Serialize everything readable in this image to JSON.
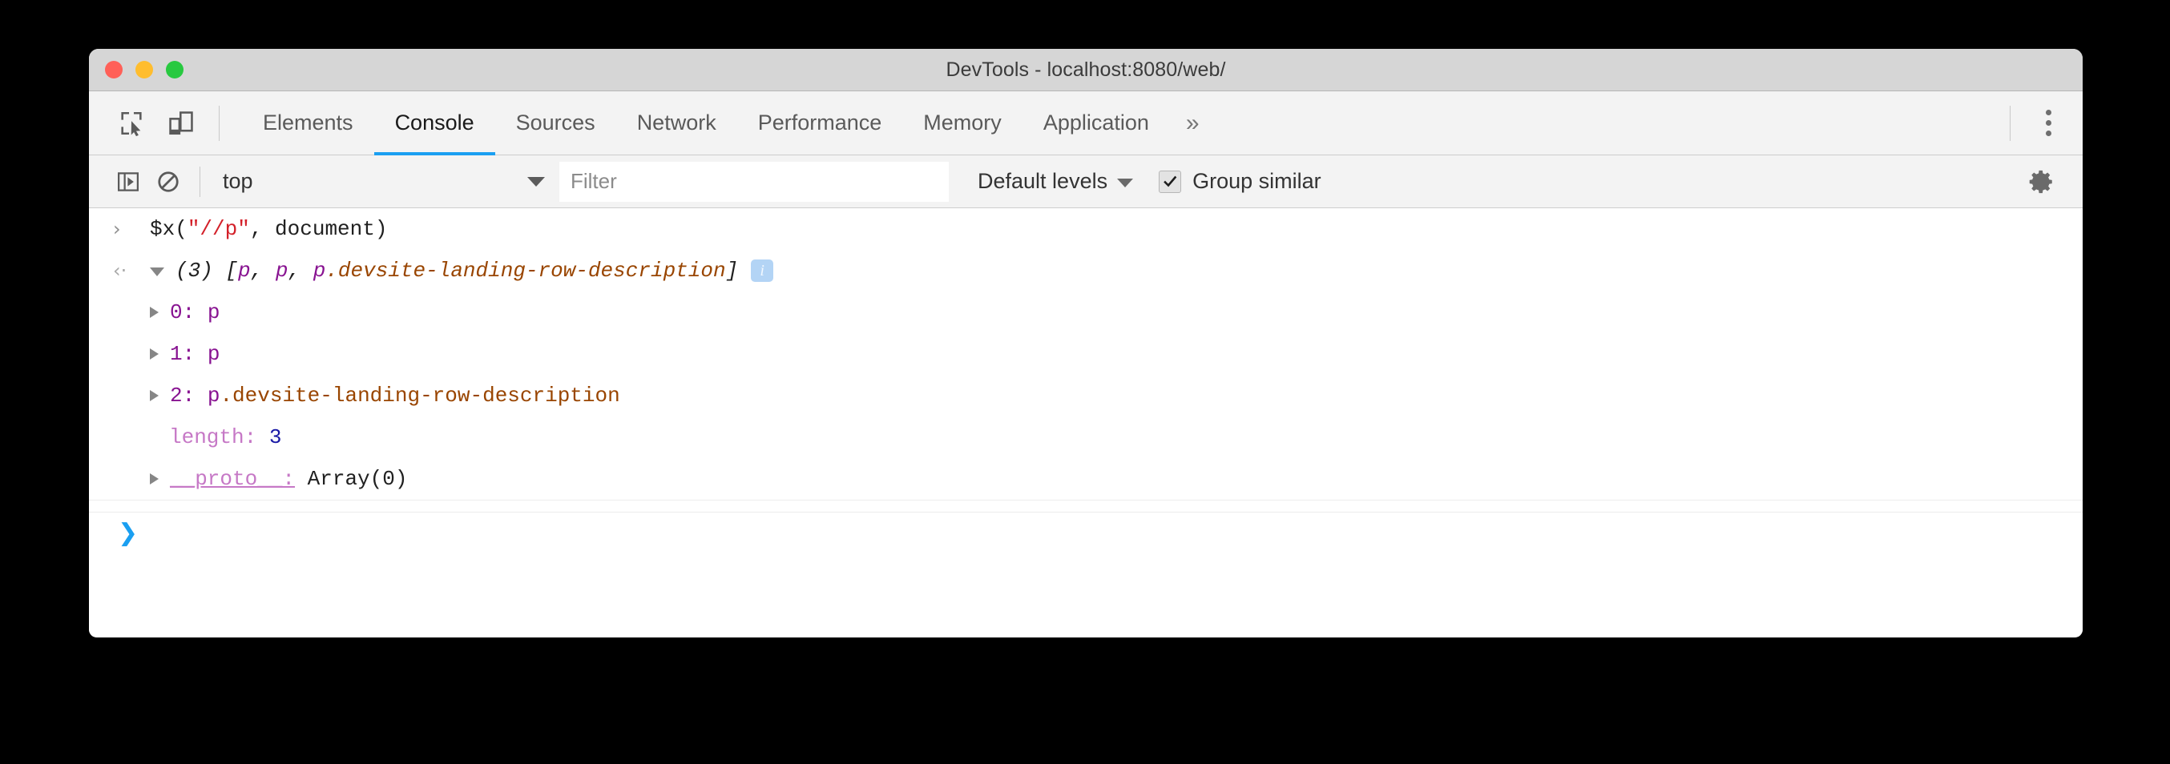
{
  "window": {
    "title": "DevTools - localhost:8080/web/"
  },
  "tabbar": {
    "inspect_icon": "inspect-element-icon",
    "device_icon": "device-toolbar-icon",
    "tabs": [
      {
        "label": "Elements",
        "active": false
      },
      {
        "label": "Console",
        "active": true
      },
      {
        "label": "Sources",
        "active": false
      },
      {
        "label": "Network",
        "active": false
      },
      {
        "label": "Performance",
        "active": false
      },
      {
        "label": "Memory",
        "active": false
      },
      {
        "label": "Application",
        "active": false
      }
    ],
    "more_tabs_label": "»",
    "kebab_icon": "more-options-icon"
  },
  "console_toolbar": {
    "sidebar_toggle_icon": "console-sidebar-icon",
    "clear_icon": "clear-console-icon",
    "context": "top",
    "filter_placeholder": "Filter",
    "filter_value": "",
    "levels_label": "Default levels",
    "group_similar_label": "Group similar",
    "group_similar_checked": true,
    "settings_icon": "gear-icon"
  },
  "console": {
    "input_line": {
      "prompt": "›",
      "code_before": "$x(",
      "code_string": "\"//p\"",
      "code_after": ", document)"
    },
    "result_line": {
      "return_arrow": "‹·",
      "count": "(3)",
      "bracket_open": "[",
      "item1": "p",
      "sep1": ", ",
      "item2": "p",
      "sep2": ", ",
      "item3_tag": "p",
      "item3_class": ".devsite-landing-row-description",
      "bracket_close": "]",
      "info_badge": "i"
    },
    "properties": [
      {
        "key": "0:",
        "value_tag": "p",
        "value_class": "",
        "expandable": true,
        "key_style": "node",
        "value_style": "node"
      },
      {
        "key": "1:",
        "value_tag": "p",
        "value_class": "",
        "expandable": true,
        "key_style": "node",
        "value_style": "node"
      },
      {
        "key": "2:",
        "value_tag": "p",
        "value_class": ".devsite-landing-row-description",
        "expandable": true,
        "key_style": "node",
        "value_style": "node"
      },
      {
        "key": "length:",
        "value_tag": "3",
        "value_class": "",
        "expandable": false,
        "key_style": "prop",
        "value_style": "number"
      },
      {
        "key": "__proto__:",
        "value_tag": "Array(0)",
        "value_class": "",
        "expandable": true,
        "key_style": "proto",
        "value_style": "plain"
      }
    ],
    "bottom_prompt": "❯"
  },
  "colors": {
    "accent": "#1a9ff1",
    "string": "#d32029",
    "node": "#881391",
    "classname": "#994500",
    "number": "#1a1aa6",
    "property": "#c678c6",
    "titlebar": "#d6d6d6",
    "toolbar": "#f3f3f3"
  }
}
